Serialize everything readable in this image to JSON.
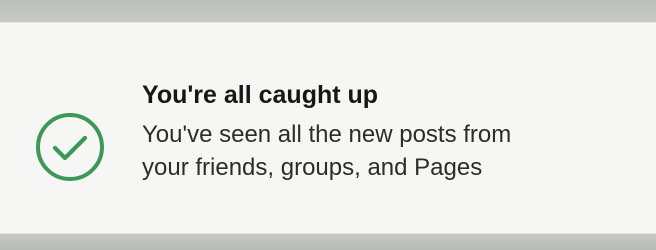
{
  "notice": {
    "title": "You're all caught up",
    "message": "You've seen all the new posts from your friends, groups, and Pages",
    "icon": "check-circle-icon",
    "accent_color": "#3a9a55"
  },
  "colors": {
    "card_background": "#f6f7f5",
    "page_background": "#c9cbc9",
    "title_text": "#171717",
    "body_text": "#2c2c2c"
  }
}
